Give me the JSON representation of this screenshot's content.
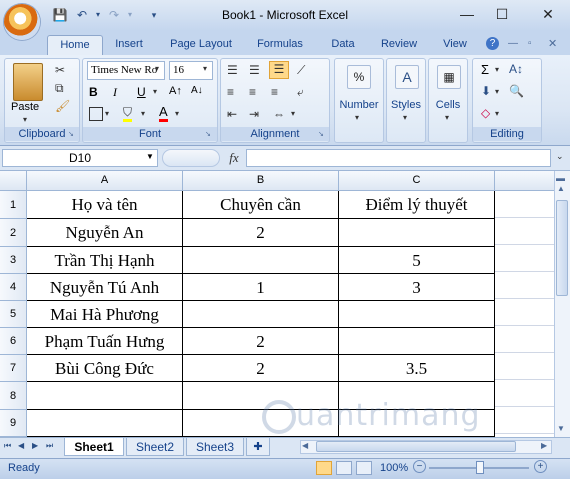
{
  "window": {
    "title": "Book1 - Microsoft Excel"
  },
  "ribbon_tabs": [
    "Home",
    "Insert",
    "Page Layout",
    "Formulas",
    "Data",
    "Review",
    "View"
  ],
  "font": {
    "name": "Times New Ro",
    "size": "16"
  },
  "groups": {
    "clipboard": {
      "label": "Clipboard",
      "paste_label": "Paste"
    },
    "font": {
      "label": "Font"
    },
    "alignment": {
      "label": "Alignment"
    },
    "number": {
      "label": "Number"
    },
    "styles": {
      "label": "Styles"
    },
    "cells": {
      "label": "Cells"
    },
    "editing": {
      "label": "Editing"
    }
  },
  "formula_bar": {
    "name_box": "D10",
    "fx": "fx",
    "value": ""
  },
  "columns": [
    "A",
    "B",
    "C"
  ],
  "rows": [
    "1",
    "2",
    "3",
    "4",
    "5",
    "6",
    "7",
    "8",
    "9"
  ],
  "cells": [
    [
      "Họ và tên",
      "Chuyên cần",
      "Điểm lý thuyết"
    ],
    [
      "Nguyễn An",
      "2",
      ""
    ],
    [
      "Trần Thị Hạnh",
      "",
      "5"
    ],
    [
      "Nguyễn Tú Anh",
      "1",
      "3"
    ],
    [
      "Mai Hà Phương",
      "",
      ""
    ],
    [
      "Phạm Tuấn Hưng",
      "2",
      ""
    ],
    [
      "Bùi Công Đức",
      "2",
      "3.5"
    ],
    [
      "",
      "",
      ""
    ],
    [
      "",
      "",
      ""
    ]
  ],
  "sheet_tabs": [
    "Sheet1",
    "Sheet2",
    "Sheet3"
  ],
  "status": {
    "ready": "Ready",
    "zoom": "100%",
    "zoom_level_percent": 100
  },
  "watermark": "uantrimang"
}
